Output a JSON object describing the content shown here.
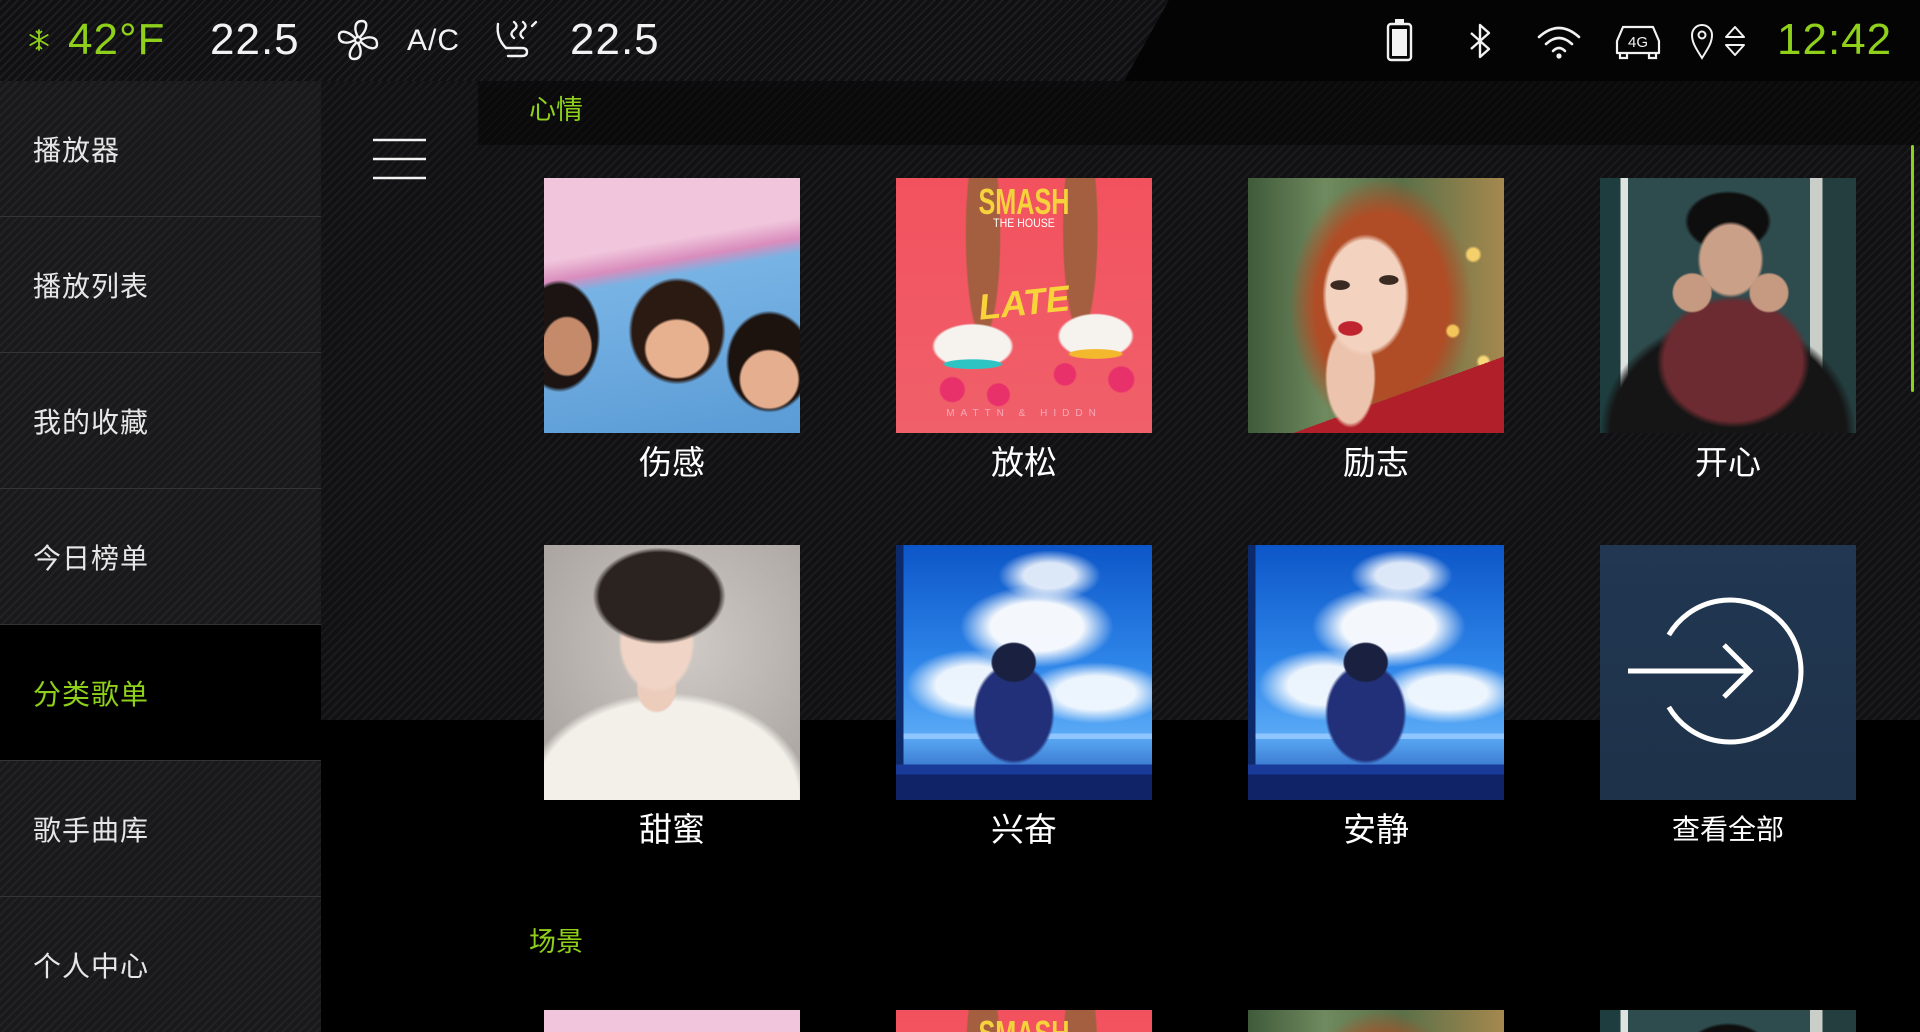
{
  "status_bar": {
    "outside_temp": "42°F",
    "driver_temp": "22.5",
    "ac_label": "A/C",
    "passenger_temp": "22.5",
    "network_label": "4G",
    "time": "12:42",
    "icons": [
      "snowflake-icon",
      "fan-icon",
      "seat-airflow-icon",
      "battery-icon",
      "bluetooth-icon",
      "wifi-icon",
      "car-4g-icon",
      "location-icon",
      "up-down-arrows-icon"
    ]
  },
  "sidebar": {
    "items": [
      {
        "label": "播放器"
      },
      {
        "label": "播放列表"
      },
      {
        "label": "我的收藏"
      },
      {
        "label": "今日榜单"
      },
      {
        "label": "分类歌单",
        "selected": true
      },
      {
        "label": "歌手曲库"
      },
      {
        "label": "个人中心"
      }
    ]
  },
  "main": {
    "menu_icon": "hamburger-menu-icon",
    "sections": [
      {
        "title": "心情",
        "cards": [
          {
            "label": "伤感"
          },
          {
            "label": "放松",
            "cover_text": {
              "top": "SMASH",
              "sub": "THE HOUSE",
              "middle": "LATE",
              "bottom": "MATTN & HIDDN"
            }
          },
          {
            "label": "励志"
          },
          {
            "label": "开心"
          },
          {
            "label": "甜蜜"
          },
          {
            "label": "兴奋"
          },
          {
            "label": "安静"
          },
          {
            "label": "查看全部",
            "icon": "arrow-into-circle-icon"
          }
        ]
      },
      {
        "title": "场景",
        "cards": [
          {},
          {
            "cover_text": {
              "top": "SMASH"
            }
          },
          {},
          {}
        ]
      }
    ]
  },
  "colors": {
    "accent": "#8fd11a",
    "background": "#000000",
    "text": "#ffffff",
    "view_all_card": "#1f344b"
  }
}
